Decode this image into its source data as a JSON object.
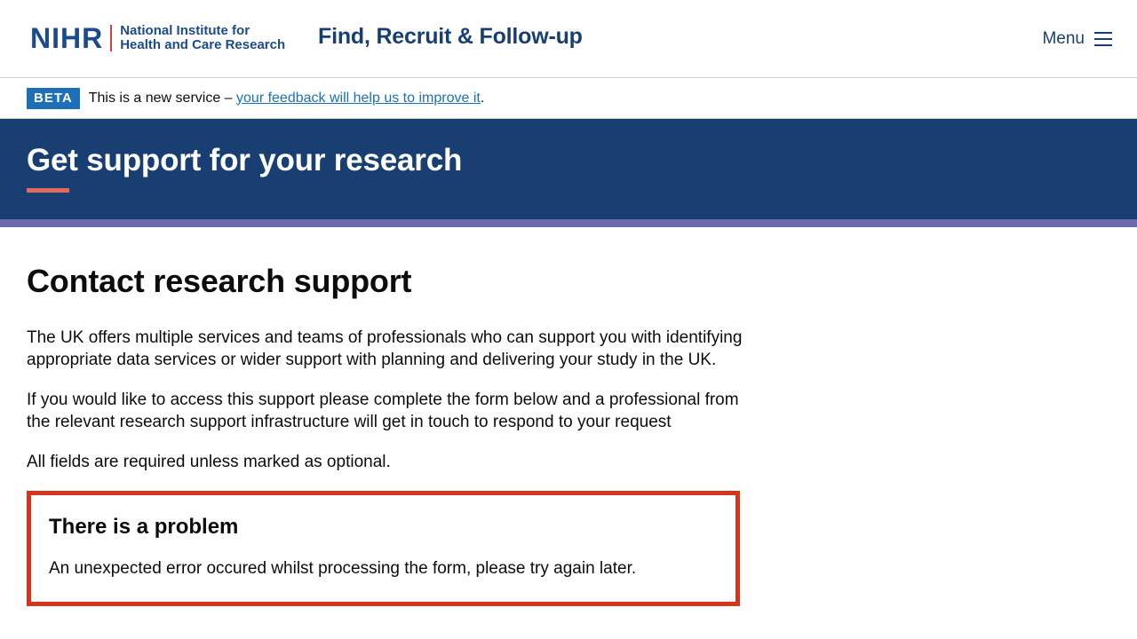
{
  "header": {
    "logo_mark": "NIHR",
    "logo_line1": "National Institute for",
    "logo_line2": "Health and Care Research",
    "service_name": "Find, Recruit & Follow-up",
    "menu_label": "Menu"
  },
  "phase_banner": {
    "tag": "BETA",
    "text_before": "This is a new service – ",
    "link_text": "your feedback will help us to improve it",
    "text_after": "."
  },
  "hero": {
    "title": "Get support for your research"
  },
  "main": {
    "page_title": "Contact research support",
    "paragraphs": [
      "The UK offers multiple services and teams of professionals who can support you with identifying appropriate data services or wider support with planning and delivering your study in the UK.",
      "If you would like to access this support please complete the form below and a professional from the relevant research support infrastructure will get in touch to respond to your request",
      "All fields are required unless marked as optional."
    ],
    "error_summary": {
      "title": "There is a problem",
      "message": "An unexpected error occured whilst processing the form, please try again later."
    }
  },
  "colors": {
    "brand_navy": "#193e72",
    "accent_red": "#d4351c",
    "link_blue": "#1d70b8",
    "band_purple": "#6c6aad"
  },
  "icons": [
    "hamburger-menu-icon"
  ]
}
